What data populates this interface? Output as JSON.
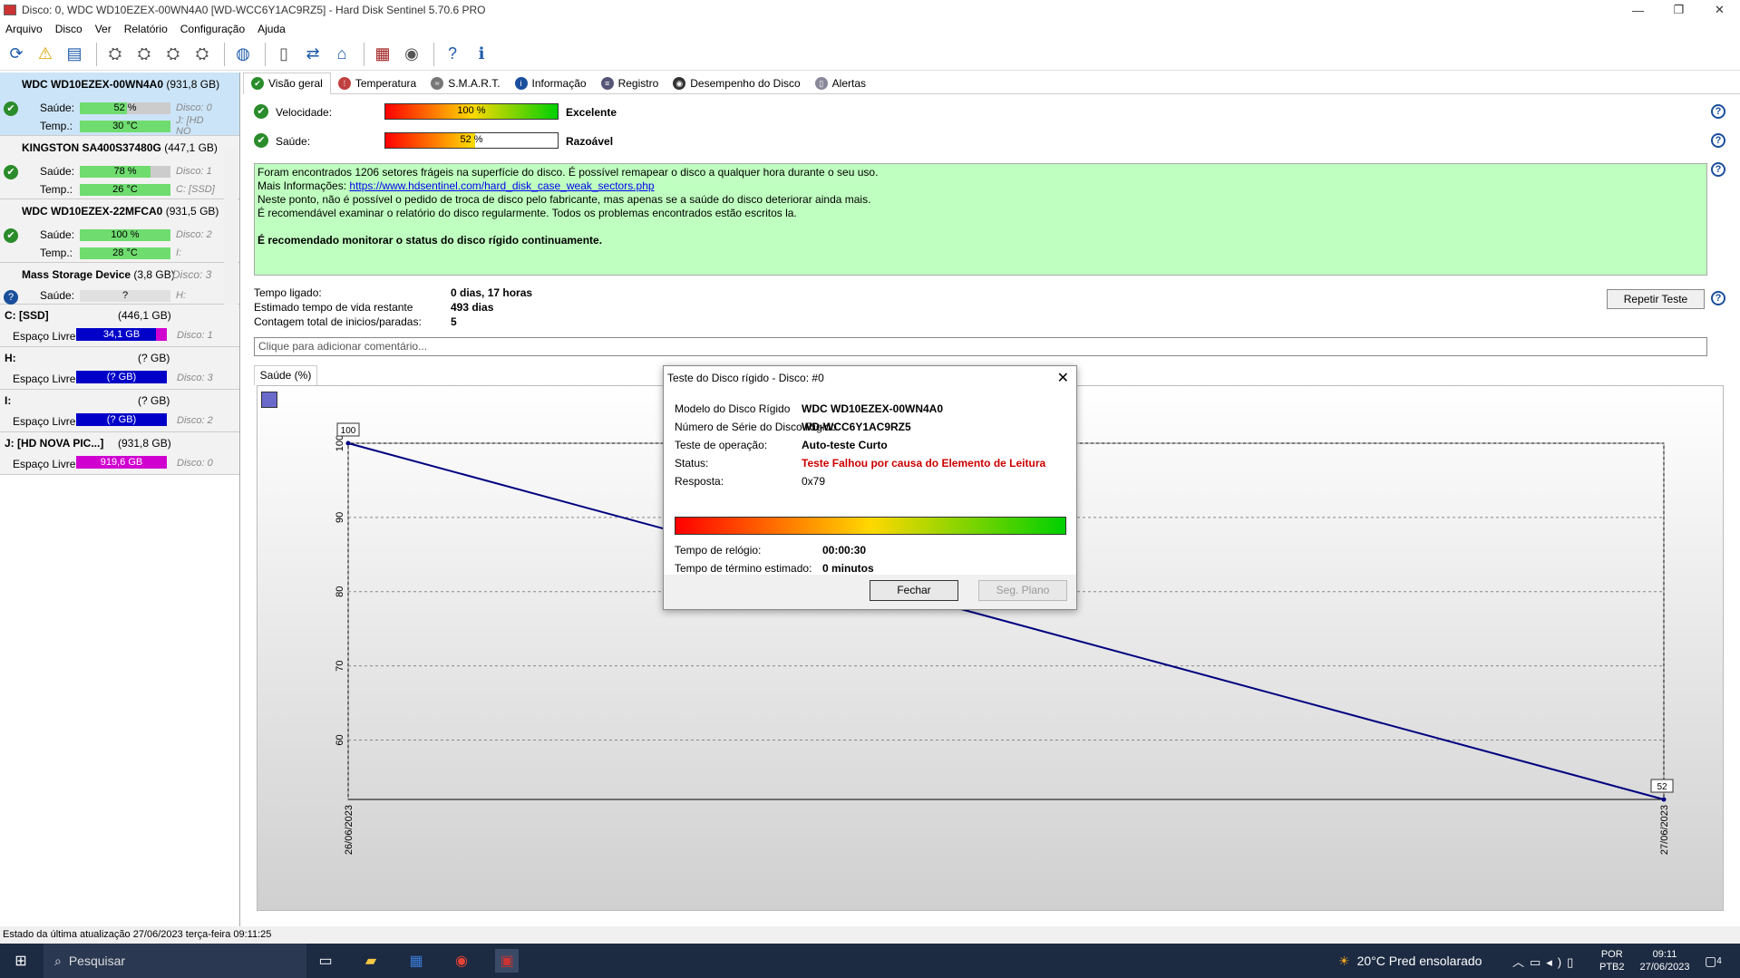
{
  "window": {
    "title": "Disco: 0, WDC WD10EZEX-00WN4A0 [WD-WCC6Y1AC9RZ5]  -  Hard Disk Sentinel 5.70.6 PRO",
    "min": "—",
    "max": "❐",
    "close": "✕"
  },
  "menu": [
    "Arquivo",
    "Disco",
    "Ver",
    "Relatório",
    "Configuração",
    "Ajuda"
  ],
  "disks": [
    {
      "name": "WDC WD10EZEX-00WN4A0",
      "size": "(931,8 GB)",
      "health_label": "Saúde:",
      "health": "52 %",
      "health_pct": 52,
      "disk_ref": "Disco: 0",
      "temp_label": "Temp.:",
      "temp": "30 °C",
      "drive": "J: [HD NO"
    },
    {
      "name": "KINGSTON SA400S37480G",
      "size": "(447,1 GB)",
      "health_label": "Saúde:",
      "health": "78 %",
      "health_pct": 78,
      "disk_ref": "Disco: 1",
      "temp_label": "Temp.:",
      "temp": "26 °C",
      "drive": "C: [SSD]"
    },
    {
      "name": "WDC WD10EZEX-22MFCA0",
      "size": "(931,5 GB)",
      "health_label": "Saúde:",
      "health": "100 %",
      "health_pct": 100,
      "disk_ref": "Disco: 2",
      "temp_label": "Temp.:",
      "temp": "28 °C",
      "drive": "I:"
    },
    {
      "name": "Mass   Storage Device",
      "size": "(3,8 GB)",
      "health_label": "Saúde:",
      "health": "?",
      "health_pct": 0,
      "disk_ref": "Disco: 3",
      "temp_label": "",
      "temp": "",
      "drive": "H:"
    }
  ],
  "volumes": [
    {
      "name": "C: [SSD]",
      "size": "(446,1 GB)",
      "free_label": "Espaço Livre",
      "free": "34,1 GB",
      "disk_ref": "Disco: 1"
    },
    {
      "name": "H:",
      "size": "(? GB)",
      "free_label": "Espaço Livre",
      "free": "(? GB)",
      "disk_ref": "Disco: 3"
    },
    {
      "name": "I:",
      "size": "(? GB)",
      "free_label": "Espaço Livre",
      "free": "(? GB)",
      "disk_ref": "Disco: 2"
    },
    {
      "name": "J: [HD NOVA PIC...]",
      "size": "(931,8 GB)",
      "free_label": "Espaço Livre",
      "free": "919,6 GB",
      "disk_ref": "Disco: 0"
    }
  ],
  "tabs": [
    "Visão geral",
    "Temperatura",
    "S.M.A.R.T.",
    "Informação",
    "Registro",
    "Desempenho do Disco",
    "Alertas"
  ],
  "overview": {
    "speed_label": "Velocidade:",
    "speed_value": "100 %",
    "speed_pct": 100,
    "speed_status": "Excelente",
    "health_label": "Saúde:",
    "health_value": "52 %",
    "health_pct": 52,
    "health_status": "Razoável",
    "info_lines": [
      "Foram encontrados 1206 setores frágeis na superfície do disco. É possível remapear o disco a qualquer hora durante o seu uso.",
      "Neste ponto, não é possível o pedido de troca de disco pelo fabricante, mas apenas se a saúde do disco deteriorar ainda mais.",
      "É recomendável examinar o relatório do disco regularmente. Todos os problemas encontrados estão escritos la."
    ],
    "info_more_label": "Mais Informações:",
    "info_link": "https://www.hdsentinel.com/hard_disk_case_weak_sectors.php",
    "info_recommend": "É recomendado monitorar o status do disco rígido continuamente.",
    "power_on_label": "Tempo ligado:",
    "power_on": "0 dias, 17 horas",
    "lifetime_label": "Estimado tempo de vida restante",
    "lifetime": "493 dias",
    "starts_label": "Contagem total de inicios/paradas:",
    "starts": "5",
    "repeat_button": "Repetir Teste",
    "comment_placeholder": "Clique para adicionar  comentário..."
  },
  "chart_tab": "Saúde (%)",
  "chart_data": {
    "type": "line",
    "x": [
      "26/06/2023",
      "27/06/2023"
    ],
    "series": [
      {
        "values": [
          100,
          52
        ]
      }
    ],
    "point_labels": [
      "100",
      "52"
    ],
    "yticks": [
      60,
      70,
      80,
      90,
      100
    ],
    "ylim": [
      52,
      100
    ],
    "grid": true,
    "line_color": "#000080"
  },
  "dialog": {
    "title": "Teste do Disco rígido - Disco: #0",
    "model_label": "Modelo do Disco Rígido",
    "model": "WDC WD10EZEX-00WN4A0",
    "serial_label": "Número de Série do Disco Rígido",
    "serial": "WD-WCC6Y1AC9RZ5",
    "op_label": "Teste de operação:",
    "op": "Auto-teste Curto",
    "status_label": "Status:",
    "status": "Teste Falhou por causa do Elemento de Leitura",
    "response_label": "Resposta:",
    "response": "0x79",
    "clock_label": "Tempo de relógio:",
    "clock": "00:00:30",
    "eta_label": "Tempo de término estimado:",
    "eta": "0 minutos",
    "close_button": "Fechar",
    "background_button": "Seg. Plano"
  },
  "statusbar": "Estado da última atualização 27/06/2023 terça-feira 09:11:25",
  "taskbar": {
    "search": "Pesquisar",
    "weather": "20°C  Pred ensolarado",
    "lang1": "POR",
    "lang2": "PTB2",
    "time": "09:11",
    "date": "27/06/2023",
    "notif": "4"
  }
}
